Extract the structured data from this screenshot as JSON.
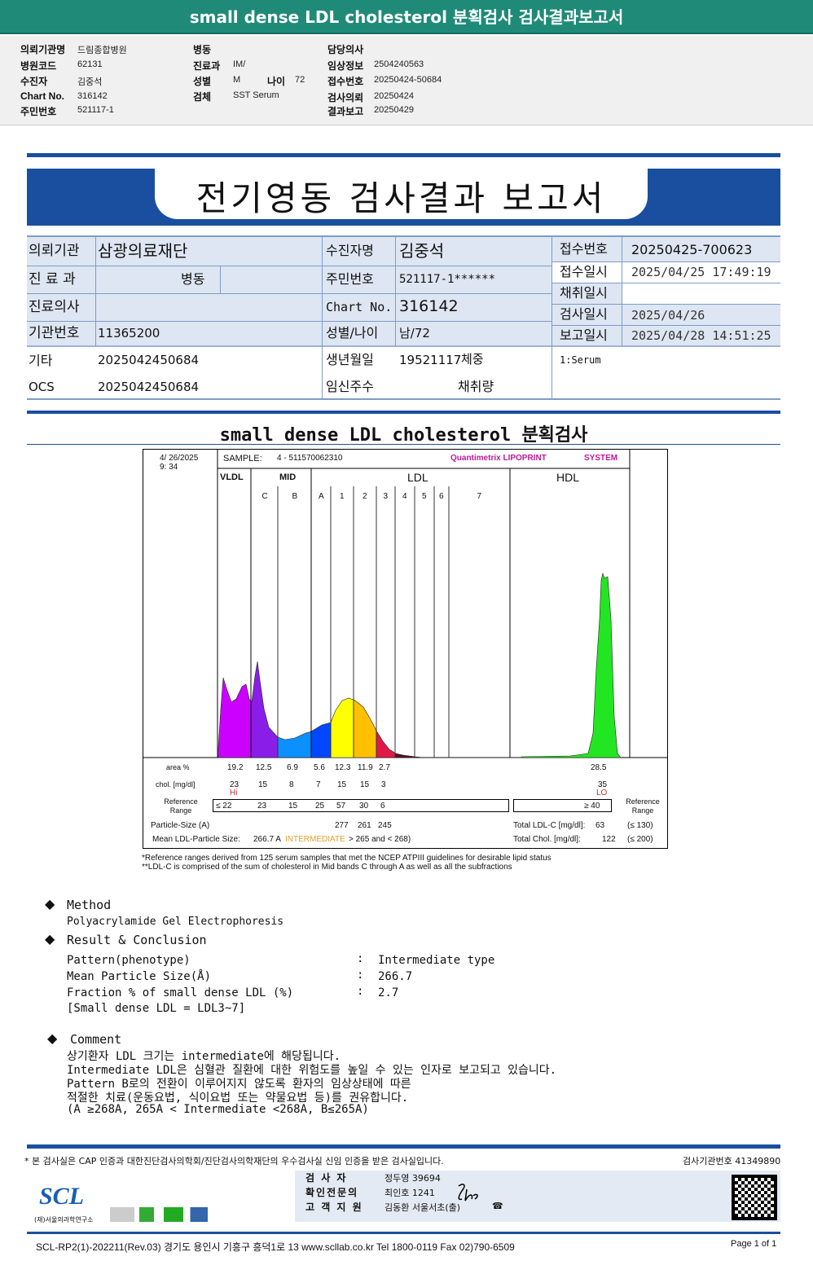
{
  "header": {
    "title": "small dense LDL cholesterol 분획검사 검사결과보고서"
  },
  "info": {
    "col1": [
      {
        "label": "의뢰기관명",
        "value": "드림종합병원"
      },
      {
        "label": "병원코드",
        "value": "62131"
      },
      {
        "label": "수진자",
        "value": "김중석"
      },
      {
        "label": "Chart No.",
        "value": "316142"
      },
      {
        "label": "주민번호",
        "value": "521117-1"
      }
    ],
    "col2": [
      {
        "label": "병동",
        "value": ""
      },
      {
        "label": "진료과",
        "value": "IM/"
      },
      {
        "label": "성별",
        "value": "M"
      },
      {
        "label": "검체",
        "value": "SST Serum"
      }
    ],
    "age_label": "나이",
    "age_value": "72",
    "col3": [
      {
        "label": "담당의사",
        "value": ""
      },
      {
        "label": "임상정보",
        "value": "2504240563"
      },
      {
        "label": "접수번호",
        "value": "20250424-50684"
      },
      {
        "label": "검사의뢰",
        "value": "20250424"
      },
      {
        "label": "결과보고",
        "value": "20250429"
      }
    ]
  },
  "report": {
    "title": "전기영동 검사결과 보고서"
  },
  "patient": {
    "institution_label": "의뢰기관",
    "institution": "삼광의료재단",
    "dept_label": "진 료 과",
    "ward_label": "병동",
    "doctor_label": "진료의사",
    "inst_no_label": "기관번호",
    "inst_no": "11365200",
    "etc_label": "기타",
    "etc": "2025042450684",
    "ocs_label": "OCS",
    "ocs": "2025042450684",
    "name_label": "수진자명",
    "name": "김중석",
    "rrn_label": "주민번호",
    "rrn": "521117-1******",
    "chart_label": "Chart No.",
    "chart": "316142",
    "sexage_label": "성별/나이",
    "sexage": "남/72",
    "birth_label": "생년월일",
    "birth": "19521117",
    "weight_label": "체중",
    "preg_label": "임신주수",
    "volume_label": "채취량",
    "recv_no_label": "접수번호",
    "recv_no": "20250425-700623",
    "recv_time_label": "접수일시",
    "recv_time": "2025/04/25 17:49:19",
    "collect_label": "채취일시",
    "test_label": "검사일시",
    "test_time": "2025/04/26",
    "report_label": "보고일시",
    "report_time": "2025/04/28 14:51:25",
    "specimen": "1:Serum"
  },
  "test_title": "small dense LDL cholesterol 분획검사",
  "chart_data": {
    "type": "area",
    "date": "4/ 26/2025",
    "time": "9: 34",
    "sample_label": "SAMPLE:",
    "sample": "4 - 511570062310",
    "brand": "Quantimetrix LIPOPRINT",
    "brand2": "SYSTEM",
    "groups": [
      "VLDL",
      "MID",
      "LDL",
      "HDL"
    ],
    "bands": [
      "C",
      "B",
      "A",
      "1",
      "2",
      "3",
      "4",
      "5",
      "6",
      "7"
    ],
    "band_colors": {
      "VLDL": "#cc00ff",
      "C": "#8a1ee8",
      "B": "#0a90ff",
      "A": "#0048ff",
      "1": "#ffff00",
      "2": "#ffc000",
      "3": "#e0184a",
      "rest": "#551122",
      "HDL": "#22e622"
    },
    "area_label": "area %",
    "area": [
      "19.2",
      "12.5",
      "6.9",
      "5.6",
      "12.3",
      "11.9",
      "2.7"
    ],
    "hdl_area": "28.5",
    "chol_label": "chol. [mg/dl]",
    "chol": [
      "23",
      "15",
      "8",
      "7",
      "15",
      "15",
      "3"
    ],
    "hdl_chol": "35",
    "vldl_flag": "Hi",
    "hdl_flag": "LO",
    "ref_label": "Reference Range",
    "ref": [
      "≤ 22",
      "23",
      "15",
      "25",
      "57",
      "30",
      "6"
    ],
    "hdl_ref": "≥ 40",
    "size_label": "Particle-Size (A)",
    "sizes": [
      "277",
      "261",
      "245"
    ],
    "mean_label": "Mean LDL-Particle Size:",
    "mean_value": "266.7 A",
    "mean_class": "INTERMEDIATE",
    "mean_range": "> 265 and < 268)",
    "total_ldl_label": "Total LDL-C [mg/dl]:",
    "total_ldl": "63",
    "total_ldl_ref": "(≤ 130)",
    "total_chol_label": "Total Chol. [mg/dl]:",
    "total_chol": "122",
    "total_chol_ref": "(≤ 200)",
    "footnote1": "*Reference ranges derived from 125 serum samples that met the NCEP ATPIII guidelines for desirable lipid status",
    "footnote2": "**LDL-C is comprised of the sum of cholesterol in Mid bands C through A as well as all the subfractions"
  },
  "method": {
    "title": "Method",
    "text": "Polyacrylamide Gel Electrophoresis"
  },
  "result": {
    "title": "Result & Conclusion",
    "rows": [
      {
        "label": "Pattern(phenotype)",
        "value": "Intermediate type"
      },
      {
        "label": "Mean Particle Size(Å)",
        "value": "266.7"
      },
      {
        "label": "Fraction % of small dense LDL (%)",
        "value": "2.7"
      }
    ],
    "note": "[Small dense LDL = LDL3~7]"
  },
  "comment": {
    "title": "Comment",
    "lines": [
      "상기환자 LDL 크기는 intermediate에 해당됩니다.",
      "Intermediate LDL은 심혈관 질환에 대한 위험도를 높일 수 있는 인자로 보고되고 있습니다.",
      "Pattern B로의 전환이 이루어지지 않도록 환자의 임상상태에 따른",
      "적절한 치료(운동요법, 식이요법 또는 약물요법 등)를 권유합니다.",
      "(A ≥268A, 265A < Intermediate <268A, B≤265A)"
    ]
  },
  "footer": {
    "cert": "* 본 검사실은 CAP 인증과 대한진단검사의학회/진단검사의학재단의 우수검사실 신임 인증을 받은 검사실입니다.",
    "lab_no": "검사기관번호 41349890",
    "tester_label": "검 사 자",
    "tester": "정두영 39694",
    "confirm_label": "확인전문의",
    "confirm": "최인호 1241",
    "support_label": "고 객 지 원",
    "support": "김동환 서울서초(출)",
    "logo": "SCL",
    "logo_sub": "(재)서울의과학연구소",
    "address": "SCL-RP2(1)-202211(Rev.03) 경기도 용인시 기흥구 흥덕1로 13 www.scllab.co.kr Tel 1800-0119 Fax 02)790-6509",
    "page": "Page 1 of 1"
  }
}
